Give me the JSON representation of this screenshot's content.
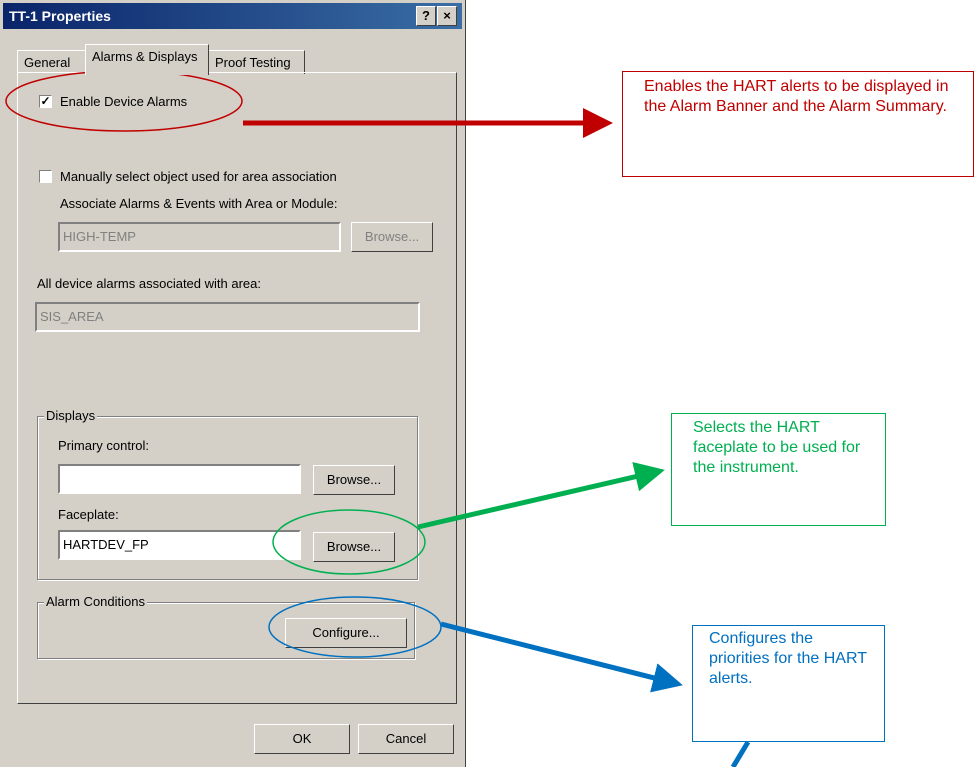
{
  "dialog": {
    "title": "TT-1 Properties",
    "help_btn": "?",
    "close_btn": "×",
    "tabs": [
      "General",
      "Alarms & Displays",
      "Proof Testing"
    ],
    "enable_alarms_label": "Enable Device Alarms",
    "enable_alarms_checked": true,
    "manual_select_label": "Manually select object used for area association",
    "associate_label": "Associate Alarms & Events with Area or Module:",
    "associate_value": "HIGH-TEMP",
    "browse_label": "Browse...",
    "all_alarms_label": "All device alarms associated with area:",
    "all_alarms_value": "SIS_AREA",
    "displays_group": "Displays",
    "primary_control_label": "Primary control:",
    "primary_control_value": "",
    "faceplate_label": "Faceplate:",
    "faceplate_value": "HARTDEV_FP",
    "alarm_conditions_group": "Alarm Conditions",
    "configure_label": "Configure...",
    "ok_label": "OK",
    "cancel_label": "Cancel"
  },
  "callouts": {
    "alarms": "Enables the HART alerts to be displayed in the Alarm Banner and the Alarm Summary.",
    "faceplate": "Selects the HART faceplate to be used for the instrument.",
    "configure": "Configures the priorities for the HART alerts."
  },
  "colors": {
    "red": "#c00000",
    "green": "#00b050",
    "blue": "#0070c0"
  }
}
